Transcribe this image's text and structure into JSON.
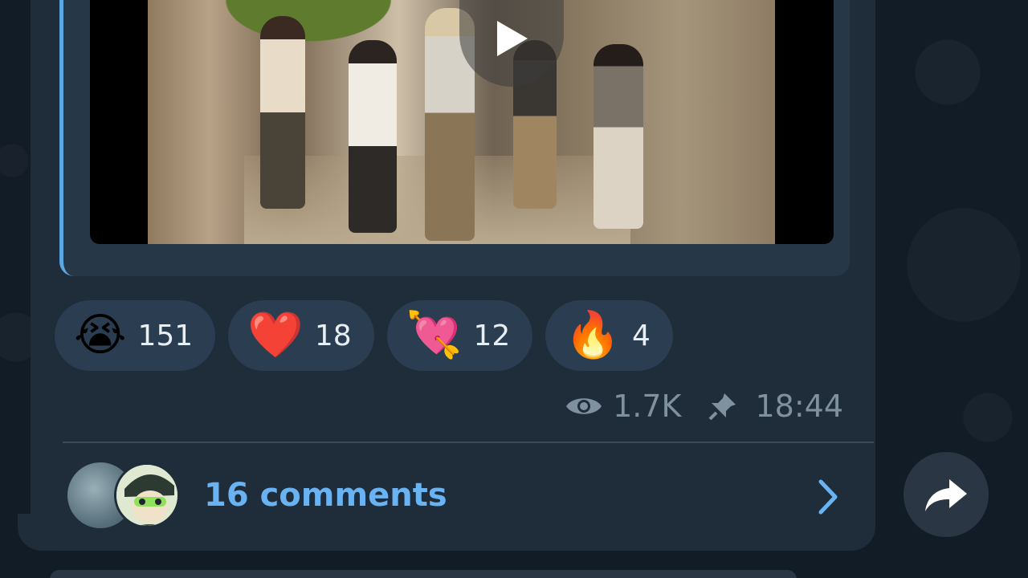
{
  "post": {
    "reactions": [
      {
        "emoji": "😭",
        "icon": "loudly-crying-face-icon",
        "count": "151"
      },
      {
        "emoji": "❤️",
        "icon": "red-heart-icon",
        "count": "18"
      },
      {
        "emoji": "💘",
        "icon": "heart-with-arrow-icon",
        "count": "12"
      },
      {
        "emoji": "🔥",
        "icon": "fire-icon",
        "count": "4"
      }
    ],
    "views": "1.7K",
    "time": "18:44",
    "comments_label": "16 comments"
  },
  "colors": {
    "accent": "#6ab3f3",
    "bubble": "#1f2c3a",
    "reaction_bg": "#2b3d50",
    "meta_text": "#7f909f"
  }
}
